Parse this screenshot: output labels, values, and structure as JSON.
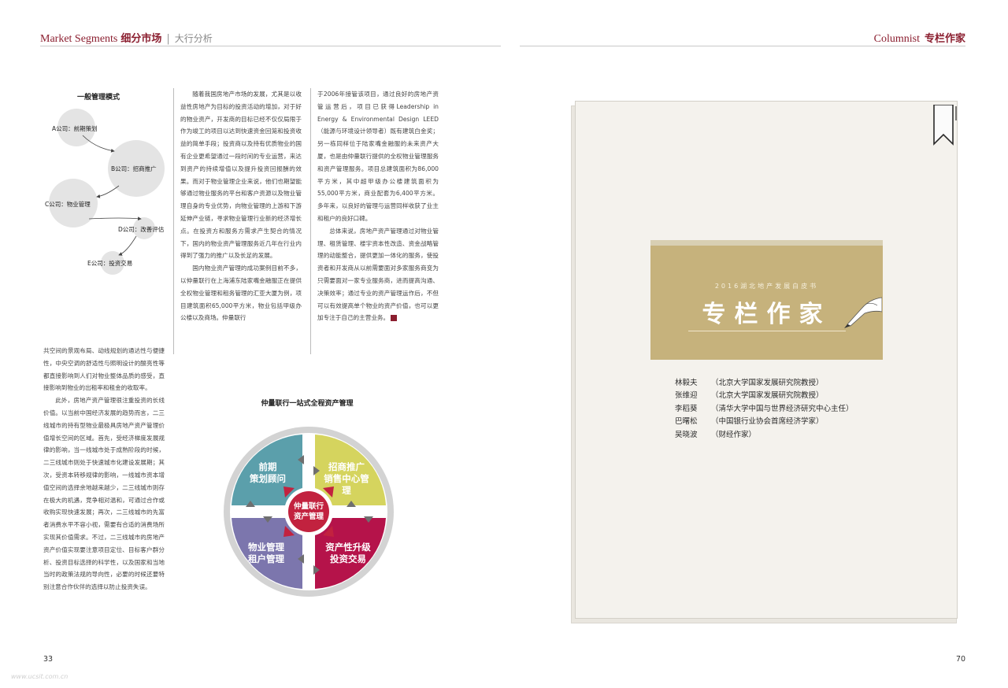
{
  "header": {
    "left_en": "Market Segments",
    "left_cn": "细分市场",
    "left_sep": "|",
    "left_sub": "大行分析",
    "right_en": "Columnist",
    "right_cn": "专栏作家"
  },
  "left_page": {
    "diagram": {
      "title": "一般管理模式",
      "nodes": [
        "A公司：前期策划",
        "B公司：招商推广",
        "C公司：物业管理",
        "D公司：改善评估",
        "E公司：投资交易"
      ]
    },
    "col1_paragraphs": [
      "共空间的景观布局、动线规划的通达性与便捷性，中央空调的舒适性与照明设计的酸亮性等都直接影响到人们对物业整体品质的感受，直接影响到物业的出租率和租金的收取率。",
      "此外，房地产资产管理很注重投资的长线价值。以当前中国经济发展的趋势而言，二三线城市的持有型物业最极具房地产资产管理价值增长空间的区域。首先，受经济梯度发展规律的影响，当一线城市处于成熟阶段的时候，二三线城市则处于快速城市化建设发展期；其次，受资本转移规律的影响，一线城市资本增值空间的选择余地越来越少，二三线城市则存在极大的机遇，竞争相对温和，可通过合作或收购实现快速发展；再次，二三线城市的先富者消费水平不容小视，需要有合适的消费场所实现其价值需求。不过，二三线城市的房地产资产价值实现要注意项目定位、目标客户群分析、投资目标选择的科学性，以及国家和当地当时的政策法规的导向性，必要的时候还要特别注意合作伙伴的选择以防止投资失误。"
    ],
    "col2_paragraphs": [
      "随着我国房地产市场的发展，尤其是以收益性房地产为目标的投资活动的增加，对于好的物业资产，开发商的目标已经不仅仅局限于作为竣工的项目以达到快速资金回笼和投资收益的简单手段；投资商以及持有优质物业的国有企业更希望通过一段时间的专业运营，来达到资产的持续增值以及提升投资回报酬的效果。而对于物业管理企业来说，他们也期望能够通过物业服务的平台和客户资源以及物业管理自身的专业优势，向物业管理的上游和下游延伸产业链，寻求物业管理行业新的经济增长点。在投资方和服务方需求产生契合的情况下，国内的物业资产管理服务近几年在行业内得到了强力的推广以及长足的发展。",
      "国内物业资产管理的成功案例目前不多，以仲量联行在上海浦东陆家嘴金融服正在提供全权物业管理和租务管理的汇亚大厦为例，项目建筑面积65,000平方米，物业包括甲级办公楼以及商场。仲量联行"
    ],
    "col3_paragraphs": [
      "于2006年接管该项目，通过良好的房地产资管运营后，项目已获得Leadership in Energy & Environmental Design LEED（能源与环境设计领导者）既有建筑白金奖；另一栋同样位于陆家嘴金融服的未来资产大厦，也是由仲量联行提供的全权物业管理服务和资产管理服务。项目总建筑面积为86,000平方米，其中超甲级办公楼建筑面积为55,000平方米，商业配套为6,400平方米。多年来，以良好的管理与运营同样收获了业主和租户的良好口碑。",
      "总体来说，房地产资产管理通过对物业管理、租赁管理、楼宇资本性改造、资金战略管理的动能整合，提供更加一体化的服务，使投资者和开发商从以前需要面对多家服务商变为只需要面对一家专业服务商，进而提高沟通、决策效率；通过专业的资产管理运作后，不但可以有效提高单个物业的资产价值，也可以更加专注于自己的主营业务。"
    ],
    "wheel": {
      "title": "仲量联行一站式全程资产管理",
      "top_left": [
        "前期",
        "策划顾问"
      ],
      "top_right": [
        "招商推广",
        "销售中心管",
        "理"
      ],
      "bottom_left": [
        "物业管理",
        "租户管理"
      ],
      "bottom_right": [
        "资产性升级",
        "投资交易"
      ],
      "center": [
        "仲量联行",
        "资产管理"
      ],
      "colors": {
        "top_left": "#5b9fab",
        "top_right": "#d5d45e",
        "bottom_left": "#7c76ad",
        "bottom_right": "#b5134a",
        "center": "#c2223f",
        "ring": "#d3d3d3"
      }
    },
    "page_number": "33"
  },
  "right_page": {
    "banner_subtitle": "2016湖北地产发展白皮书",
    "banner_title": "专栏作家",
    "authors": [
      {
        "name": "林毅夫",
        "title": "（北京大学国家发展研究院教授）"
      },
      {
        "name": "张维迎",
        "title": "（北京大学国家发展研究院教授）"
      },
      {
        "name": "李稻葵",
        "title": "（清华大学中国与世界经济研究中心主任）"
      },
      {
        "name": "巴曙松",
        "title": "（中国银行业协会首席经济学家）"
      },
      {
        "name": "吴晓波",
        "title": "（财经作家）"
      }
    ],
    "page_number": "70"
  },
  "watermark": "www.ucsit.com.cn"
}
